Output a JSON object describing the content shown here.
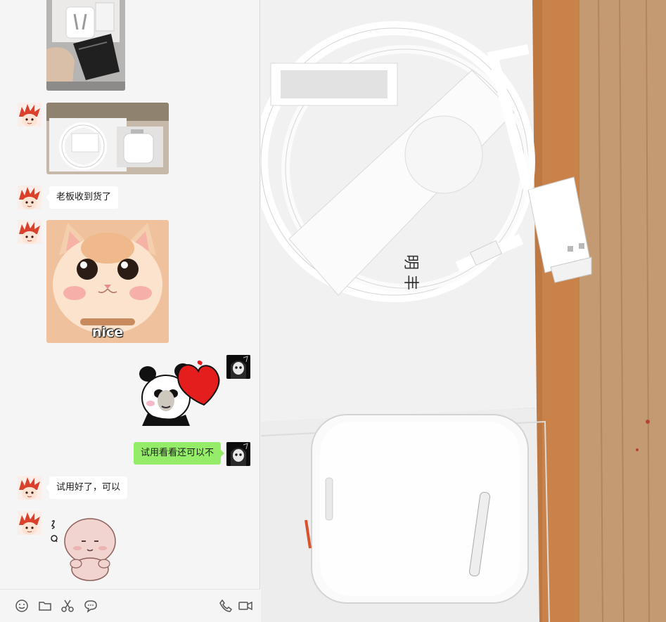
{
  "messages": [
    {
      "from": "friend",
      "type": "image",
      "content_icon": "airpods-unboxing-photo"
    },
    {
      "from": "friend",
      "type": "image",
      "content_icon": "airpods-box-photo"
    },
    {
      "from": "friend",
      "type": "text",
      "text": "老板收到货了"
    },
    {
      "from": "friend",
      "type": "image",
      "content_icon": "cat-sticker",
      "caption": "nice"
    },
    {
      "from": "self",
      "type": "sticker",
      "content_icon": "panda-heart-sticker"
    },
    {
      "from": "self",
      "type": "text",
      "text": "试用看看还可以不"
    },
    {
      "from": "friend",
      "type": "text",
      "text": "试用好了，可以"
    },
    {
      "from": "friend",
      "type": "sticker",
      "content_icon": "pink-blob-sticker"
    }
  ],
  "toolbar": {
    "left": [
      "emoji-icon",
      "folder-icon",
      "scissors-icon",
      "chat-bubble-icon"
    ],
    "right": [
      "phone-icon",
      "video-icon"
    ]
  },
  "viewer": {
    "content_icon": "airpods-cable-photo",
    "paper_text": "明 丰"
  },
  "colors": {
    "chat_bg": "#f5f5f5",
    "bubble_in": "#ffffff",
    "bubble_out": "#95ec69"
  }
}
